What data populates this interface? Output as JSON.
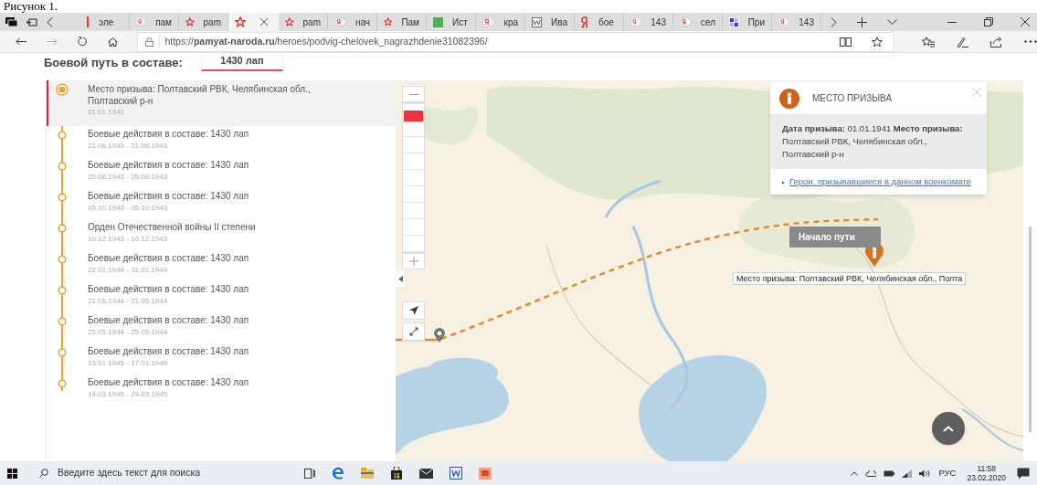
{
  "caption": "Рисунок 1.",
  "tabs": [
    {
      "label": "эле",
      "kind": "redbar",
      "selected": false
    },
    {
      "label": "пам",
      "kind": "yandex",
      "selected": false
    },
    {
      "label": "pam",
      "kind": "star",
      "selected": false
    },
    {
      "kind": "star",
      "selected": true
    },
    {
      "label": "pam",
      "kind": "star",
      "selected": false
    },
    {
      "label": "нач",
      "kind": "yandex",
      "selected": false
    },
    {
      "label": "Пам",
      "kind": "star",
      "selected": false
    },
    {
      "label": "Ист",
      "kind": "green",
      "selected": false
    },
    {
      "label": "кра",
      "kind": "yandex",
      "selected": false
    },
    {
      "label": "Ива",
      "kind": "wiki",
      "selected": false
    },
    {
      "label": "бое",
      "kind": "yaletter",
      "selected": false
    },
    {
      "label": "143",
      "kind": "yandex",
      "selected": false
    },
    {
      "label": "сел",
      "kind": "yandex",
      "selected": false
    },
    {
      "label": "При",
      "kind": "lib",
      "selected": false
    },
    {
      "label": "143",
      "kind": "yandex",
      "selected": false
    }
  ],
  "address": "https://**pamyat-naroda.ru**/heroes/podvig-chelovek_nagrazhdenie31082396/",
  "heading": "Боевой путь в составе:",
  "unit_tab": "1430 лап",
  "events": [
    {
      "title": "Место призыва: Полтавский РВК, Челябинская обл., Полтавский р-н",
      "date": "01.01.1941",
      "selected": true
    },
    {
      "title": "Боевые действия в составе: 1430 лап",
      "date": "21.08.1943 - 21.08.1943",
      "selected": false
    },
    {
      "title": "Боевые действия в составе: 1430 лап",
      "date": "25.08.1943 - 25.08.1943",
      "selected": false
    },
    {
      "title": "Боевые действия в составе: 1430 лап",
      "date": "05.10.1943 - 05.10.1943",
      "selected": false
    },
    {
      "title": "Орден Отечественной войны II степени",
      "date": "10.12.1943 - 10.12.1943",
      "selected": false
    },
    {
      "title": "Боевые действия в составе: 1430 лап",
      "date": "22.01.1944 - 31.01.1944",
      "selected": false
    },
    {
      "title": "Боевые действия в составе: 1430 лап",
      "date": "21.05.1944 - 21.05.1944",
      "selected": false
    },
    {
      "title": "Боевые действия в составе: 1430 лап",
      "date": "25.05.1944 - 25.05.1944",
      "selected": false
    },
    {
      "title": "Боевые действия в составе: 1430 лап",
      "date": "13.01.1945 - 17.01.1945",
      "selected": false
    },
    {
      "title": "Боевые действия в составе: 1430 лап",
      "date": "14.03.1945 - 24.03.1945",
      "selected": false
    }
  ],
  "map": {
    "zoom": {
      "level": 0.95
    },
    "popup": {
      "title": "МЕСТО ПРИЗЫВА",
      "details": "**Дата призыва:** 01.01.1941 **Место призыва:** Полтавский РВК, Челябинская обл., Полтавский р-н",
      "link": "Герои, призывавшиеся в данном военкомате"
    },
    "start_label": "Начало пути",
    "tooltip": "Место призыва: Полтавский РВК, Челябинская обл., Полта"
  },
  "taskbar": {
    "search_placeholder": "Введите здесь текст для поиска",
    "language": "РУС",
    "time": "11:58",
    "date": "23.02.2020"
  }
}
